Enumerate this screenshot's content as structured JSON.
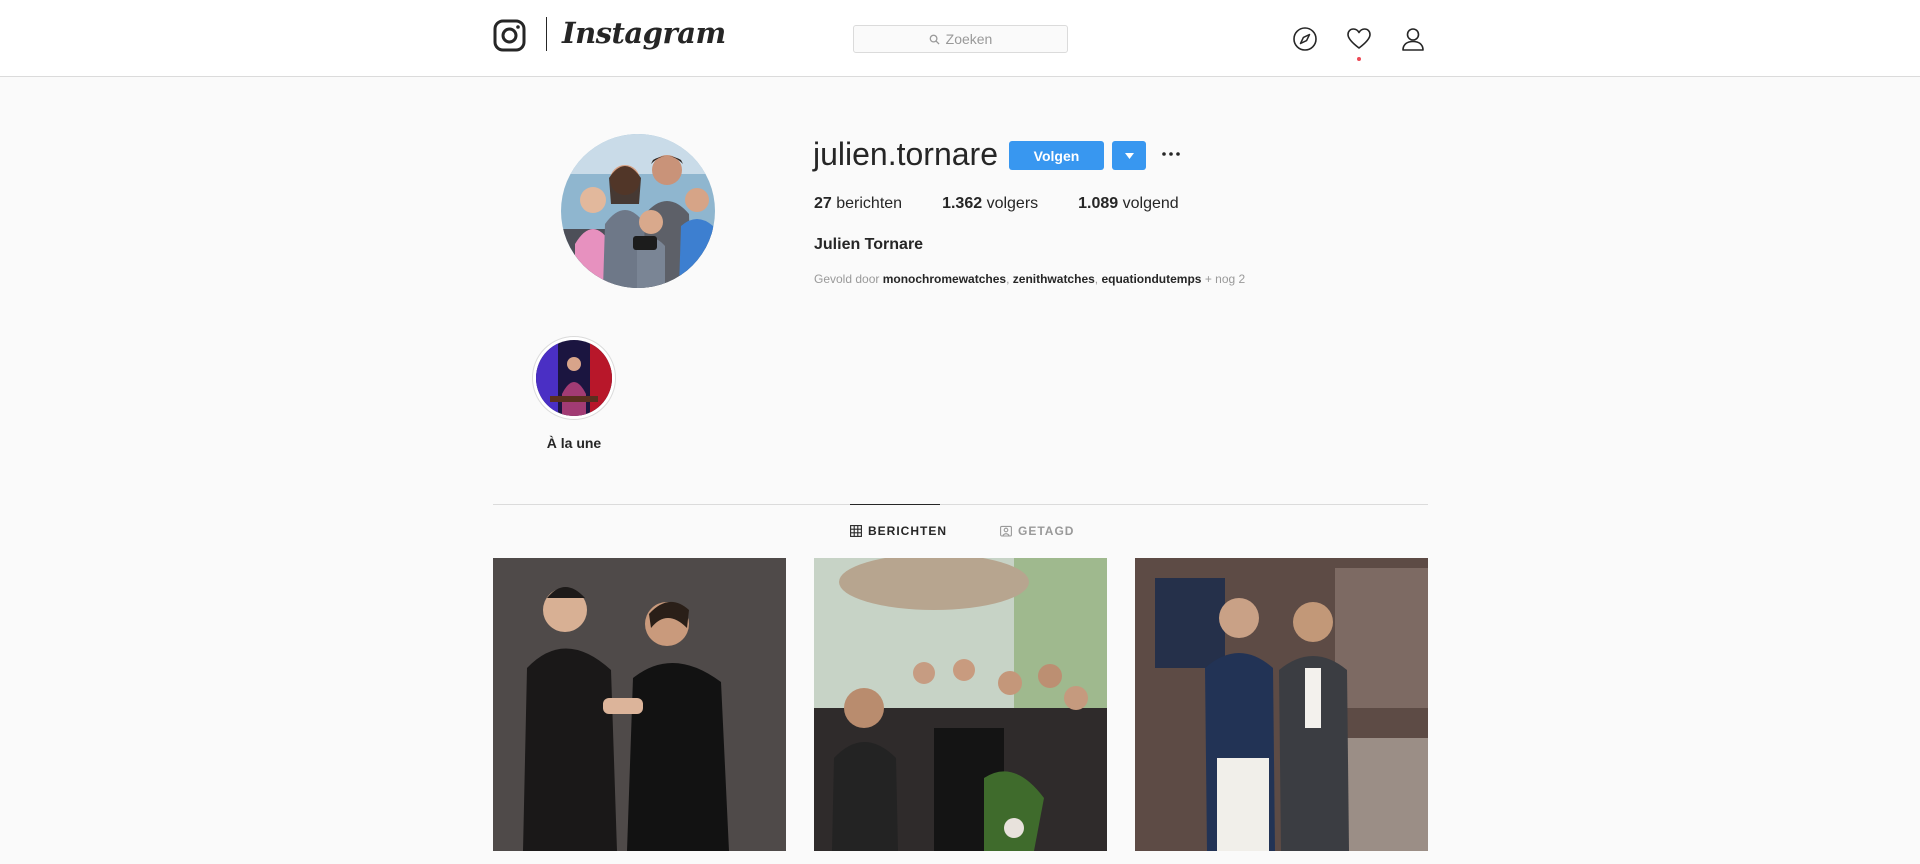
{
  "header": {
    "logo_text": "Instagram",
    "search_placeholder": "Zoeken",
    "icons": [
      "camera-logo-icon",
      "explore-compass-icon",
      "activity-heart-icon",
      "profile-person-icon"
    ]
  },
  "profile": {
    "username": "julien.tornare",
    "follow_label": "Volgen",
    "stats": {
      "posts_count": "27",
      "posts_label": "berichten",
      "followers_count": "1.362",
      "followers_label": "volgers",
      "following_count": "1.089",
      "following_label": "volgend"
    },
    "full_name": "Julien Tornare",
    "followed_by": {
      "prefix": "Gevold door",
      "accounts": [
        "monochromewatches",
        "zenithwatches",
        "equationdutemps"
      ],
      "suffix": "+ nog 2"
    }
  },
  "highlights": [
    {
      "label": "À la une"
    }
  ],
  "tabs": [
    {
      "label": "BERICHTEN",
      "active": true
    },
    {
      "label": "GETAGD",
      "active": false
    }
  ],
  "colors": {
    "accent": "#3897f0",
    "notification_dot": "#ed4956",
    "muted_text": "#999999",
    "border": "#dbdbdb"
  }
}
